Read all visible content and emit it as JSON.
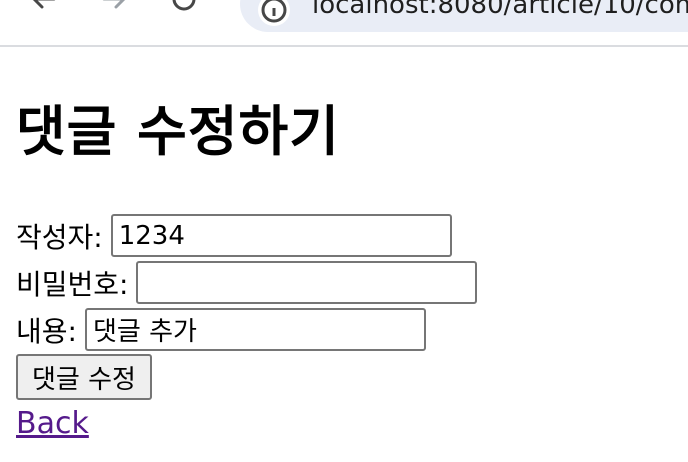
{
  "browser": {
    "url": "localhost:8080/article/10/com"
  },
  "page": {
    "title": "댓글 수정하기"
  },
  "form": {
    "author_label": "작성자:",
    "author_value": "1234",
    "password_label": "비밀번호:",
    "password_value": "",
    "content_label": "내용:",
    "content_value": "댓글 추가",
    "submit_label": "댓글 수정"
  },
  "back_link": "Back",
  "colors": {
    "link_visited": "#551a8b",
    "address_bar": "#e9edf6",
    "button_bg": "#efefef"
  },
  "icons": [
    "back-arrow-icon",
    "forward-arrow-icon",
    "reload-icon",
    "site-info-icon"
  ]
}
